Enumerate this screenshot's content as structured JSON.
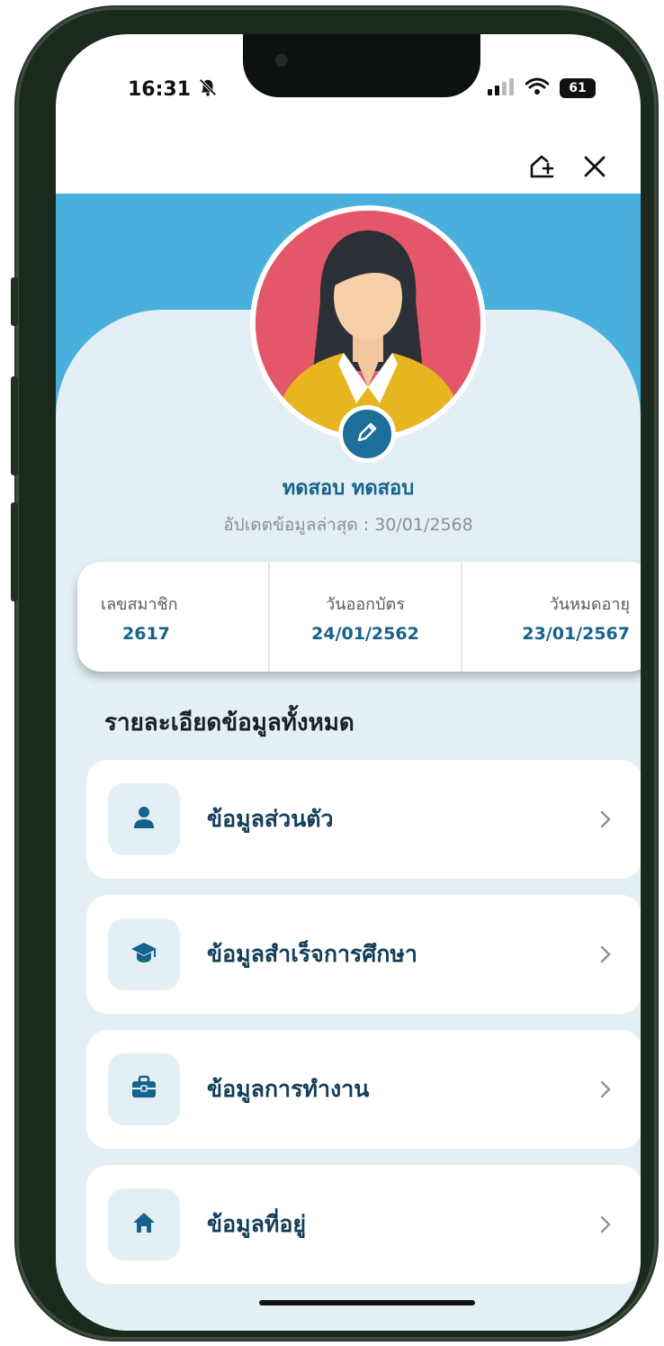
{
  "status": {
    "time": "16:31",
    "battery": "61"
  },
  "profile": {
    "name": "ทดสอบ ทดสอบ",
    "updated": "อัปเดตข้อมูลล่าสุด : 30/01/2568"
  },
  "info": {
    "member_label": "เลขสมาชิก",
    "member_value": "2617",
    "issue_label": "วันออกบัตร",
    "issue_value": "24/01/2562",
    "expiry_label": "วันหมดอายุ",
    "expiry_value": "23/01/2567"
  },
  "section_title": "รายละเอียดข้อมูลทั้งหมด",
  "menu": [
    {
      "label": "ข้อมูลส่วนตัว",
      "icon": "person-icon"
    },
    {
      "label": "ข้อมูลสำเร็จการศึกษา",
      "icon": "graduation-cap-icon"
    },
    {
      "label": "ข้อมูลการทำงาน",
      "icon": "briefcase-icon"
    },
    {
      "label": "ข้อมูลที่อยู่",
      "icon": "home-icon"
    }
  ],
  "colors": {
    "header_blue": "#49b0dd",
    "primary": "#15628c",
    "background": "#e3eff5",
    "avatar_bg": "#e4566a"
  }
}
